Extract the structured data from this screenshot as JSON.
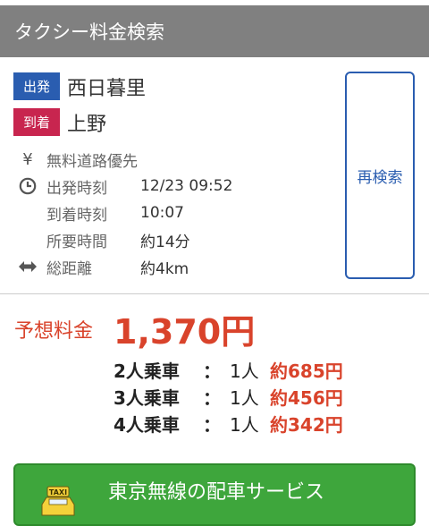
{
  "header": {
    "title": "タクシー料金検索"
  },
  "route": {
    "departure_badge": "出発",
    "departure_station": "西日暮里",
    "arrival_badge": "到着",
    "arrival_station": "上野",
    "toll_setting": "無料道路優先",
    "depart_time_label": "出発時刻",
    "depart_time_value": "12/23 09:52",
    "arrive_time_label": "到着時刻",
    "arrive_time_value": "10:07",
    "duration_label": "所要時間",
    "duration_value": "約14分",
    "distance_label": "総距離",
    "distance_value": "約4km",
    "research_button": "再検索"
  },
  "fare": {
    "label": "予想料金",
    "amount": "1,370円",
    "splits": [
      {
        "riders": "2人乗車",
        "colon": "：",
        "per": "1人",
        "amount": "約685円"
      },
      {
        "riders": "3人乗車",
        "colon": "：",
        "per": "1人",
        "amount": "約456円"
      },
      {
        "riders": "4人乗車",
        "colon": "：",
        "per": "1人",
        "amount": "約342円"
      }
    ]
  },
  "banner": {
    "text": "東京無線の配車サービス",
    "icon_label": "TAXI"
  }
}
